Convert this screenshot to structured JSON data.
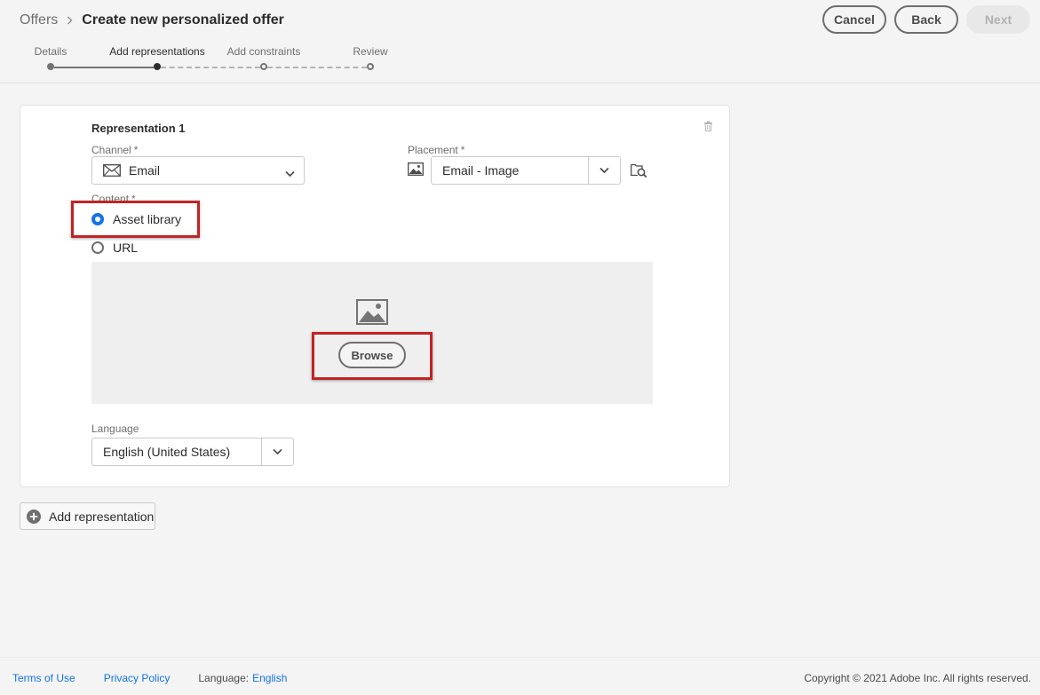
{
  "header": {
    "breadcrumb_root": "Offers",
    "title": "Create new personalized offer",
    "cancel_label": "Cancel",
    "back_label": "Back",
    "next_label": "Next"
  },
  "steps": [
    {
      "label": "Details",
      "state": "done"
    },
    {
      "label": "Add representations",
      "state": "current"
    },
    {
      "label": "Add constraints",
      "state": "todo"
    },
    {
      "label": "Review",
      "state": "todo"
    }
  ],
  "representation": {
    "title": "Representation 1",
    "channel_label": "Channel",
    "channel_value": "Email",
    "channel_icon": "mail-icon",
    "placement_label": "Placement",
    "placement_value": "Email - Image",
    "placement_icon": "image-icon",
    "content_label": "Content",
    "required_marker": "*",
    "content_options": [
      {
        "label": "Asset library",
        "selected": true
      },
      {
        "label": "URL",
        "selected": false
      }
    ],
    "browse_label": "Browse",
    "language_label": "Language",
    "language_value": "English (United States)"
  },
  "add_representation_label": "Add representation",
  "footer": {
    "terms": "Terms of Use",
    "privacy": "Privacy Policy",
    "language_caption": "Language:",
    "language_value": "English",
    "copyright": "Copyright © 2021 Adobe Inc. All rights reserved."
  },
  "colors": {
    "accent": "#1473e6",
    "highlight": "#c02424",
    "background": "#f4f4f4"
  }
}
